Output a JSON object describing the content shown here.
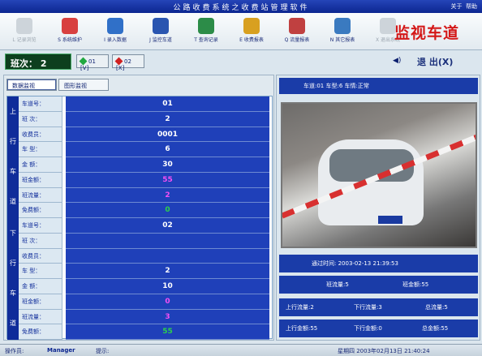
{
  "app": {
    "title": "公路收费系统之收费站管理软件",
    "help_about": "关于",
    "help": "帮助"
  },
  "toolbar": {
    "items": [
      {
        "label": "L 记录浏览",
        "icon": "document-icon",
        "enabled": false
      },
      {
        "label": "S 系统维护",
        "icon": "tools-icon",
        "enabled": true
      },
      {
        "label": "I 录入数据",
        "icon": "data-entry-icon",
        "enabled": true
      },
      {
        "label": "J 监控车道",
        "icon": "eye-icon",
        "enabled": true
      },
      {
        "label": "T 查询记录",
        "icon": "search-records-icon",
        "enabled": true
      },
      {
        "label": "E 收费报表",
        "icon": "coins-icon",
        "enabled": true
      },
      {
        "label": "Q 流量报表",
        "icon": "traffic-icon",
        "enabled": true
      },
      {
        "label": "N 其它报表",
        "icon": "notepad-icon",
        "enabled": true
      },
      {
        "label": "X 退出系统",
        "icon": "exit-icon",
        "enabled": false
      }
    ],
    "logo_text": "监视车道"
  },
  "shift": {
    "label": "班次：",
    "value": "2",
    "btn1": "01 [V]",
    "btn2": "02 [X]"
  },
  "exit": {
    "label": "退 出(X)"
  },
  "tabs": [
    {
      "label": "数据监视",
      "active": true
    },
    {
      "label": "图形监视",
      "active": false
    }
  ],
  "up_group": {
    "label": [
      "上",
      "行",
      "车",
      "道"
    ],
    "rows": [
      {
        "label": "车道号：",
        "value": "01"
      },
      {
        "label": "班  次：",
        "value": "2"
      },
      {
        "label": "收费员：",
        "value": "0001"
      },
      {
        "label": "车  型：",
        "value": "6"
      },
      {
        "label": "金  额：",
        "value": "30"
      },
      {
        "label": "班金额：",
        "value": "55"
      },
      {
        "label": "班流量：",
        "value": "2"
      },
      {
        "label": "免费额：",
        "value": "0"
      }
    ]
  },
  "down_group": {
    "label": [
      "下",
      "行",
      "车",
      "道"
    ],
    "rows": [
      {
        "label": "车道号：",
        "value": "02"
      },
      {
        "label": "班  次：",
        "value": ""
      },
      {
        "label": "收费员：",
        "value": ""
      },
      {
        "label": "车  型：",
        "value": "2"
      },
      {
        "label": "金  额：",
        "value": "10"
      },
      {
        "label": "班金额：",
        "value": "0"
      },
      {
        "label": "班流量：",
        "value": "3"
      },
      {
        "label": "免费额：",
        "value": "55"
      }
    ]
  },
  "lane_info": "车道:01   车型:6   车情:正常",
  "pass_time": "通过时间:  2003-02-13  21:39:53",
  "shift_stats": {
    "flow": "班流量:5",
    "amount": "班金额:55"
  },
  "totals": {
    "up_flow": "上行流量:2",
    "down_flow": "下行流量:3",
    "total_flow": "总流量:5",
    "up_amount": "上行金额:55",
    "down_amount": "下行金额:0",
    "total_amount": "总金额:55"
  },
  "status": {
    "operator_label": "操作员:",
    "operator": "Manager",
    "hint_label": "提示:",
    "date_text": "星期四  2003年02月13日  21:40:24"
  },
  "colors": {
    "title_bar": "#0c2690",
    "cell_blue": "#1f40b9",
    "logo_red": "#d41818"
  }
}
